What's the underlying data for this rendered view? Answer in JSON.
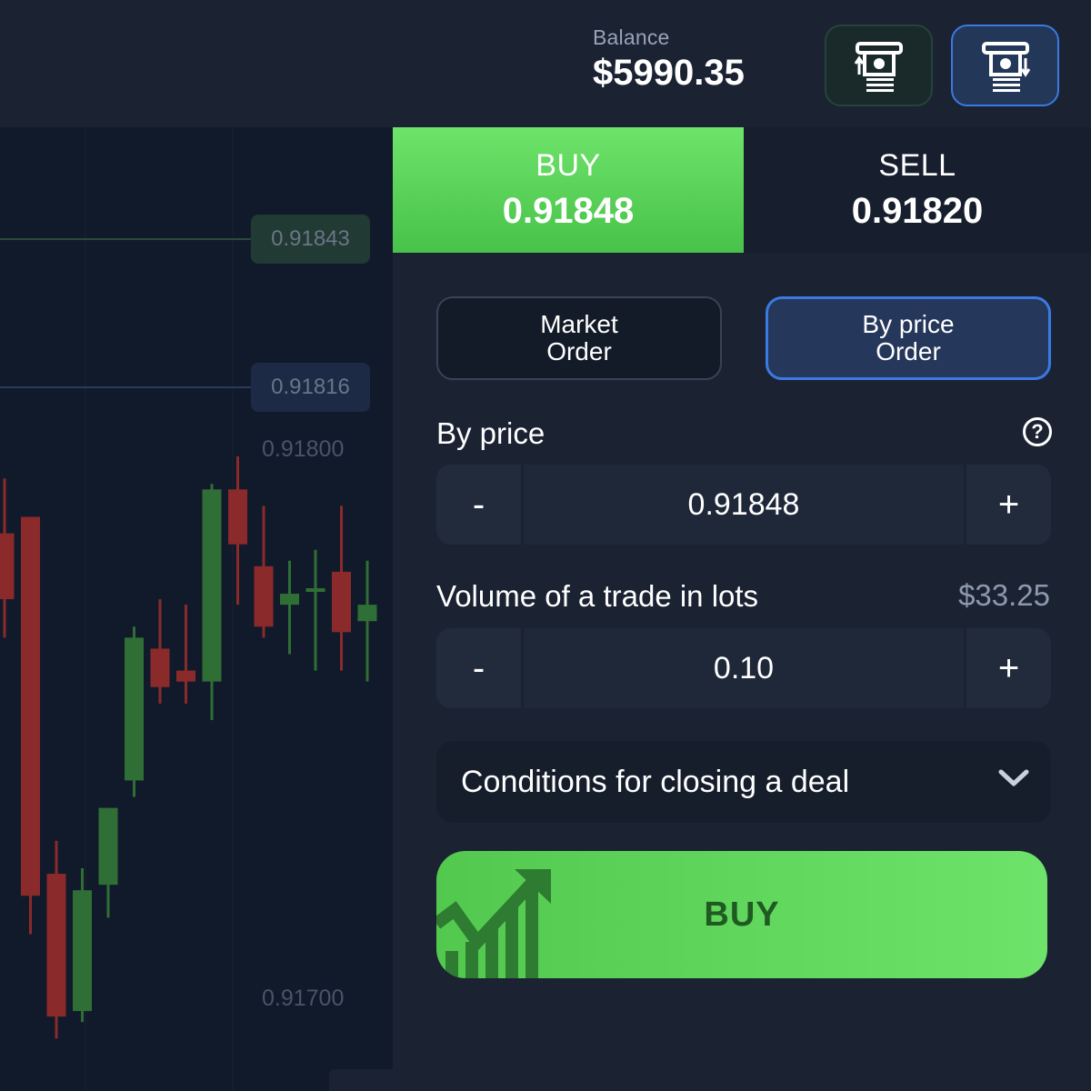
{
  "header": {
    "balance_label": "Balance",
    "balance_value": "$5990.35",
    "deposit_icon": "deposit-cash-icon",
    "withdraw_icon": "withdraw-cash-icon"
  },
  "chart": {
    "price_tags": [
      {
        "value": "0.91843",
        "color": "#213a33"
      },
      {
        "value": "0.91816",
        "color": "#1d2a45"
      }
    ],
    "axis_labels": [
      "0.91800",
      "0.91700"
    ],
    "candles": [
      {
        "open": 0.91785,
        "close": 0.91773,
        "high": 0.91795,
        "low": 0.91766
      },
      {
        "open": 0.91788,
        "close": 0.91719,
        "high": 0.91788,
        "low": 0.91712
      },
      {
        "open": 0.91723,
        "close": 0.91697,
        "high": 0.91729,
        "low": 0.91693
      },
      {
        "open": 0.91698,
        "close": 0.9172,
        "high": 0.91724,
        "low": 0.91696
      },
      {
        "open": 0.91721,
        "close": 0.91735,
        "high": 0.91735,
        "low": 0.91715
      },
      {
        "open": 0.9174,
        "close": 0.91766,
        "high": 0.91768,
        "low": 0.91737
      },
      {
        "open": 0.91764,
        "close": 0.91757,
        "high": 0.91773,
        "low": 0.91754
      },
      {
        "open": 0.9176,
        "close": 0.91758,
        "high": 0.91772,
        "low": 0.91754
      },
      {
        "open": 0.91758,
        "close": 0.91793,
        "high": 0.91794,
        "low": 0.91751
      },
      {
        "open": 0.91793,
        "close": 0.91783,
        "high": 0.91799,
        "low": 0.91772
      },
      {
        "open": 0.91779,
        "close": 0.91768,
        "high": 0.9179,
        "low": 0.91766
      },
      {
        "open": 0.91772,
        "close": 0.91774,
        "high": 0.9178,
        "low": 0.91763
      },
      {
        "open": 0.91775,
        "close": 0.91775,
        "high": 0.91782,
        "low": 0.9176
      },
      {
        "open": 0.91778,
        "close": 0.91767,
        "high": 0.9179,
        "low": 0.9176
      },
      {
        "open": 0.91769,
        "close": 0.91772,
        "high": 0.9178,
        "low": 0.91758
      }
    ],
    "up_color": "#2f6e34",
    "down_color": "#8b2a2a"
  },
  "trade": {
    "buy_tab_label": "BUY",
    "buy_price": "0.91848",
    "sell_tab_label": "SELL",
    "sell_price": "0.91820",
    "market_order_label": "Market\nOrder",
    "by_price_order_label": "By price\nOrder",
    "by_price_label": "By price",
    "price_value": "0.91848",
    "volume_label": "Volume of a trade in lots",
    "volume_usd": "$33.25",
    "volume_value": "0.10",
    "minus_label": "-",
    "plus_label": "+",
    "conditions_label": "Conditions for closing a deal",
    "buy_button_label": "BUY",
    "help_symbol": "?",
    "accent_green": "#6ee36a",
    "accent_blue": "#3b7ae3"
  }
}
